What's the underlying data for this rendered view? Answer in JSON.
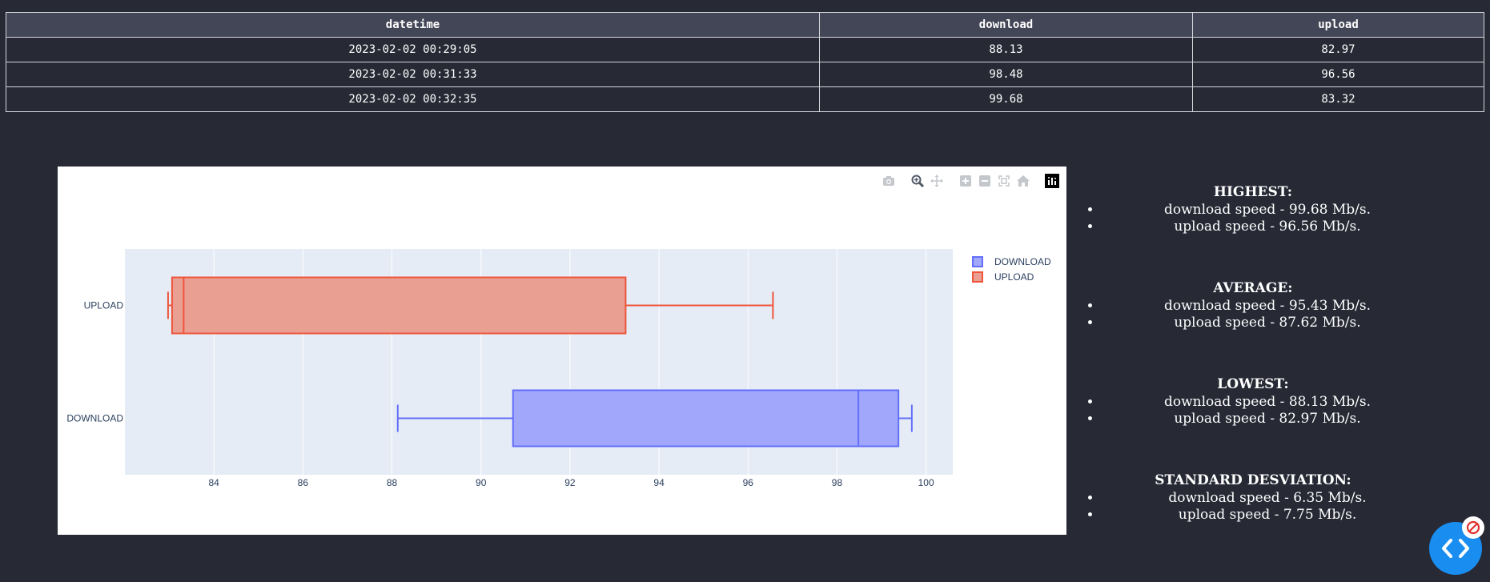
{
  "table": {
    "headers": [
      "datetime",
      "download",
      "upload"
    ],
    "rows": [
      [
        "2023-02-02 00:29:05",
        "88.13",
        "82.97"
      ],
      [
        "2023-02-02 00:31:33",
        "98.48",
        "96.56"
      ],
      [
        "2023-02-02 00:32:35",
        "99.68",
        "83.32"
      ]
    ]
  },
  "modebar": {
    "icons": [
      "camera-icon",
      "zoom-icon",
      "pan-icon",
      "zoom-in-icon",
      "zoom-out-icon",
      "autoscale-icon",
      "reset-axes-icon",
      "plotly-logo-icon"
    ]
  },
  "chart_data": {
    "type": "box",
    "orientation": "horizontal",
    "categories": [
      "UPLOAD",
      "DOWNLOAD"
    ],
    "series": [
      {
        "name": "DOWNLOAD",
        "color": "#636efa",
        "fill": "#a1a8fc",
        "values": [
          88.13,
          98.48,
          99.68
        ],
        "min": 88.13,
        "q1": 90.72,
        "median": 98.48,
        "q3": 99.38,
        "max": 99.68
      },
      {
        "name": "UPLOAD",
        "color": "#ef553b",
        "fill": "#ea9f93",
        "values": [
          82.97,
          96.56,
          83.32
        ],
        "min": 82.97,
        "q1": 83.06,
        "median": 83.32,
        "q3": 93.25,
        "max": 96.56
      }
    ],
    "xlim": [
      82.0,
      100.6
    ],
    "xticks": [
      84,
      86,
      88,
      90,
      92,
      94,
      96,
      98,
      100
    ],
    "grid": true,
    "legend": "top-right",
    "plot_bg": "#e5ecf6"
  },
  "stats": [
    {
      "title": "HIGHEST:",
      "items": [
        "download speed - 99.68 Mb/s.",
        "upload speed - 96.56 Mb/s."
      ]
    },
    {
      "title": "AVERAGE:",
      "items": [
        "download speed - 95.43 Mb/s.",
        "upload speed - 87.62 Mb/s."
      ]
    },
    {
      "title": "LOWEST:",
      "items": [
        "download speed - 88.13 Mb/s.",
        "upload speed - 82.97 Mb/s."
      ]
    },
    {
      "title": "STANDARD DESVIATION:",
      "items": [
        "download speed - 6.35 Mb/s.",
        "upload speed - 7.75 Mb/s."
      ]
    }
  ],
  "colors": {
    "background": "#272935",
    "header_bg": "#434657",
    "fab": "#1a8ef0"
  }
}
